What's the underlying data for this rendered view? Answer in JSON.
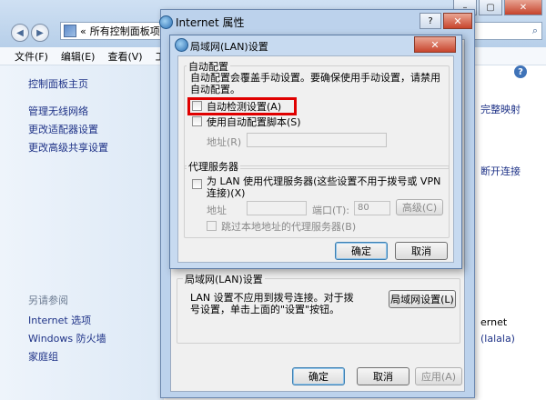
{
  "explorer": {
    "address": "所有控制面板项",
    "address_prefix": "«",
    "menu": [
      "文件(F)",
      "编辑(E)",
      "查看(V)",
      "工具"
    ],
    "sidebar_links": [
      "控制面板主页",
      "管理无线网络",
      "更改适配器设置",
      "更改高级共享设置"
    ],
    "see_also_heading": "另请参阅",
    "see_also_links": [
      "Internet 选项",
      "Windows 防火墙",
      "家庭组"
    ],
    "right_fragments": [
      "完整映射",
      "断开连接",
      "ernet",
      "(lalala)"
    ]
  },
  "props": {
    "title": "Internet 属性",
    "help_button": "?",
    "close_button": "✕",
    "lan_section_title": "局域网(LAN)设置",
    "lan_desc": "LAN 设置不应用到拨号连接。对于拨号设置，单击上面的\"设置\"按钮。",
    "lan_settings_button": "局域网设置(L)",
    "ok": "确定",
    "cancel": "取消",
    "apply": "应用(A)"
  },
  "lan": {
    "title": "局域网(LAN)设置",
    "close_button": "✕",
    "auto_group_title": "自动配置",
    "auto_desc": "自动配置会覆盖手动设置。要确保使用手动设置，请禁用自动配置。",
    "auto_detect": "自动检测设置(A)",
    "auto_detect_checked": false,
    "use_script": "使用自动配置脚本(S)",
    "use_script_checked": false,
    "address_label": "地址(R)",
    "address_value": "",
    "proxy_group_title": "代理服务器",
    "proxy_use": "为 LAN 使用代理服务器(这些设置不用于拨号或 VPN 连接)(X)",
    "proxy_use_checked": false,
    "proxy_address_label": "地址",
    "proxy_address_value": "",
    "port_label": "端口(T):",
    "port_value": "80",
    "advanced_button": "高级(C)",
    "bypass_local": "跳过本地地址的代理服务器(B)",
    "bypass_local_checked": false,
    "ok": "确定",
    "cancel": "取消"
  },
  "colors": {
    "highlight": "#e00000",
    "link": "#1e3287"
  }
}
